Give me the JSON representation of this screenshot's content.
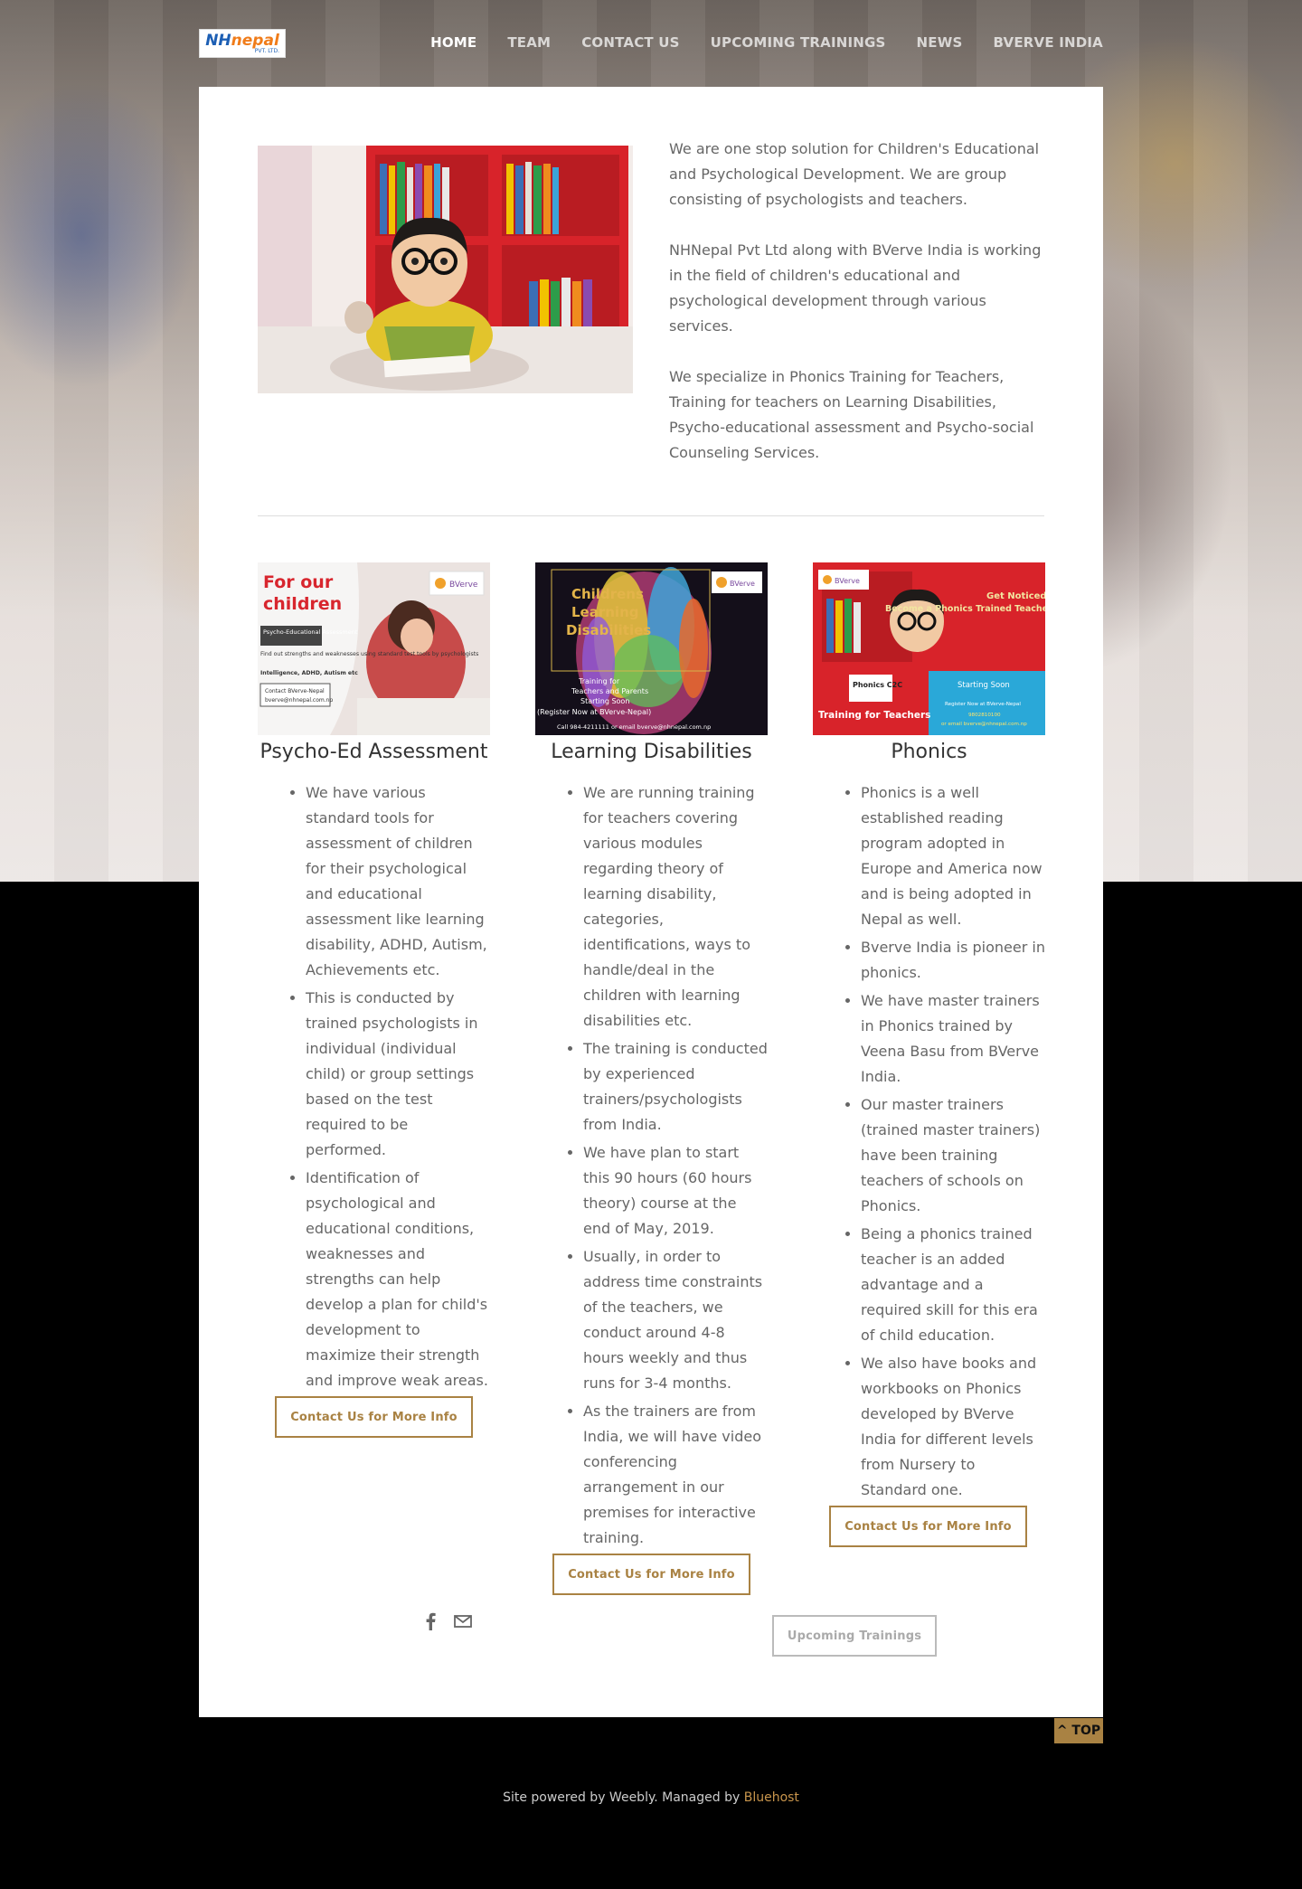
{
  "header": {
    "logo": {
      "main_1": "NH",
      "main_2": "nepal",
      "sub": "PVT. LTD."
    },
    "nav": [
      "HOME",
      "TEAM",
      "CONTACT US",
      "UPCOMING TRAININGS",
      "NEWS",
      "BVERVE INDIA"
    ],
    "active_nav": "HOME"
  },
  "intro": {
    "p1": "We are one stop solution for Children's Educational and Psychological Development. We are group consisting of psychologists and teachers.",
    "p2": "NHNepal Pvt Ltd along with BVerve India is working in the field of children's educational and psychological development through various services.",
    "p3": "We specialize in Phonics Training for Teachers, Training for teachers on Learning Disabilities, Psycho-educational assessment and Psycho-social Counseling Services."
  },
  "columns": [
    {
      "title": "Psycho-Ed Assessment",
      "image_text": {
        "headline_1": "For our",
        "headline_2": "children",
        "brand": "BVerve",
        "tag": "Psycho-Educational Assessment",
        "body": "Find out strengths and weaknesses using standard test tools by psychologists",
        "bold": "Intelligence, ADHD, Autism etc",
        "contact_1": "Contact BVerve-Nepal",
        "contact_2": "bverve@nhnepal.com.np"
      },
      "items": [
        "We have various standard tools for assessment of children for their psychological and educational assessment like learning disability, ADHD, Autism, Achievements etc.",
        "This is conducted by trained psychologists in individual (individual child) or group settings based on the test required to be performed.",
        "Identification of psychological and educational conditions, weaknesses and strengths can help develop a plan for child's development to maximize their strength and improve weak areas."
      ],
      "button": "Contact Us for More Info"
    },
    {
      "title": "Learning Disabilities",
      "image_text": {
        "headline_1": "Childrens",
        "headline_2": "Learning",
        "headline_3": "Disabilities",
        "brand": "BVerve",
        "line_1": "Training for",
        "line_2": "Teachers and Parents",
        "line_3": "Starting Soon",
        "line_4": "(Register Now at BVerve-Nepal)",
        "line_5": "Call 984-4211111 or email bverve@nhnepal.com.np"
      },
      "items": [
        "We are running training for teachers covering various modules regarding theory of learning disability, categories, identifications, ways to handle/deal in the children with learning disabilities etc.",
        "The training is conducted by experienced trainers/psychologists from India.",
        "We have plan to start this 90 hours (60 hours theory) course at the end of May, 2019.",
        "Usually, in order to address time constraints of the teachers, we conduct around 4-8 hours weekly and thus runs for 3-4 months.",
        "As the trainers are from India, we will have video conferencing arrangement in our premises for interactive training."
      ],
      "button": "Contact Us for More Info"
    },
    {
      "title": "Phonics",
      "image_text": {
        "brand": "BVerve",
        "headline_1": "Get Noticed",
        "headline_2": "Become a Phonics Trained Teacher",
        "badge": "Phonics C2C",
        "left_banner": "Training for Teachers",
        "right_1": "Starting Soon",
        "right_2": "Register Now at BVerve-Nepal",
        "right_3": "9802810100",
        "right_4": "or email bverve@nhnepal.com.np"
      },
      "items": [
        "Phonics is a well established reading program adopted in Europe and America now and is being adopted in Nepal as well.",
        "Bverve India is pioneer in phonics.",
        "We have master trainers in Phonics trained by Veena Basu from BVerve India.",
        "Our master trainers (trained master trainers) have been training teachers of schools on Phonics.",
        "Being a phonics trained teacher is an added advantage and a required skill for this era of child education.",
        "We also have books and workbooks on Phonics developed by BVerve India for different levels from Nursery to Standard one."
      ],
      "button": "Contact Us for More Info"
    }
  ],
  "upcoming_button": "Upcoming Trainings",
  "social": [
    "facebook-icon",
    "mail-icon"
  ],
  "top_button": "^ TOP",
  "footer": {
    "text": "Site powered by Weebly. Managed by ",
    "link": "Bluehost"
  },
  "colors": {
    "accent": "#a98243",
    "text": "#666666",
    "heading": "#333333",
    "footer_bg": "#000000"
  }
}
